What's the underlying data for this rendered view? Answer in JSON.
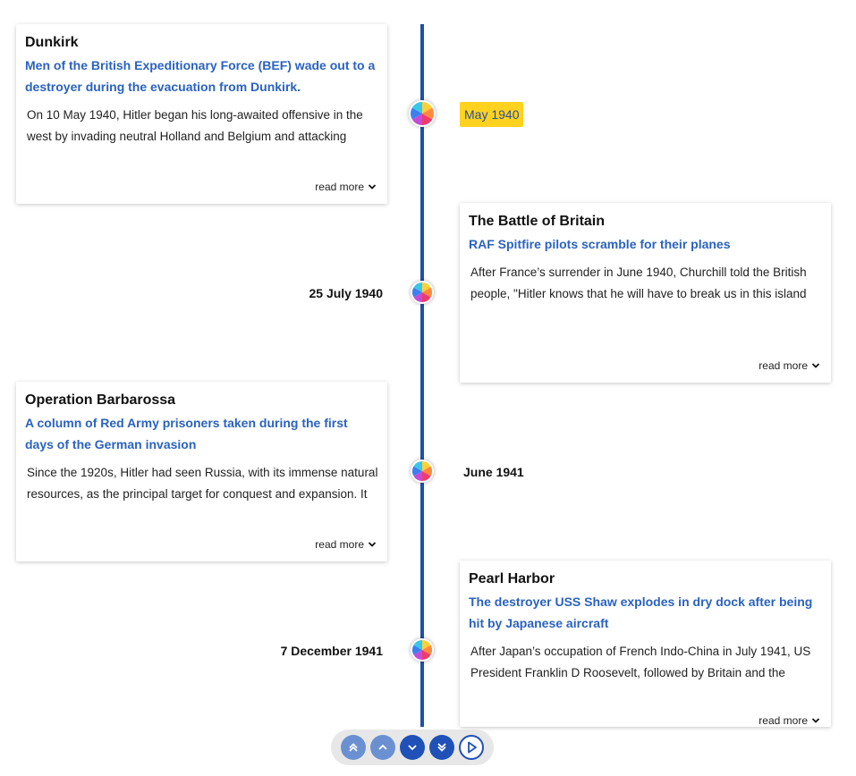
{
  "colors": {
    "axis": "#1f51a8",
    "subtitle": "#2a62c0",
    "highlight": "#ffd21f"
  },
  "events": [
    {
      "title": "Dunkirk",
      "subtitle": "Men of the British Expeditionary Force (BEF) wade out to a destroyer during the evacuation from Dunkirk.",
      "body": "On 10 May 1940, Hitler began his long-awaited offensive in the west by invading neutral Holland and Belgium and attacking",
      "date": "May 1940",
      "read_more": "read more"
    },
    {
      "title": "The Battle of Britain",
      "subtitle": "RAF Spitfire pilots scramble for their planes",
      "body": "After France’s surrender in June 1940, Churchill told the British people, \"Hitler knows that he will have to break us in this island",
      "date": "25 July 1940",
      "read_more": "read more"
    },
    {
      "title": "Operation Barbarossa",
      "subtitle": "A column of Red Army prisoners taken during the first days of the German invasion",
      "body": "Since the 1920s, Hitler had seen Russia, with its immense natural resources, as the principal target for conquest and expansion. It",
      "date": "June 1941",
      "read_more": "read more"
    },
    {
      "title": "Pearl Harbor",
      "subtitle": "The destroyer USS Shaw explodes in dry dock after being hit by Japanese aircraft",
      "body": "After Japan’s occupation of French Indo-China in July 1941, US President Franklin D Roosevelt, followed by Britain and the",
      "date": "7 December 1941",
      "read_more": "read more"
    }
  ],
  "controls": {
    "first_icon": "double-chevron-up-icon",
    "prev_icon": "chevron-up-icon",
    "next_icon": "chevron-down-icon",
    "last_icon": "double-chevron-down-icon",
    "play_icon": "play-icon"
  }
}
